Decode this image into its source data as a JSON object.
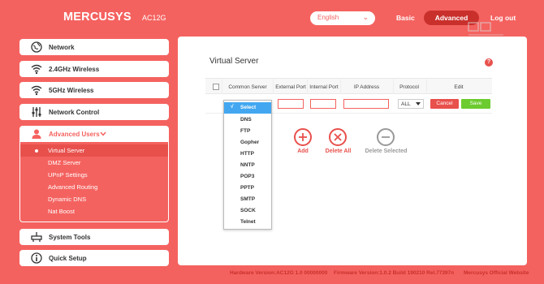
{
  "header": {
    "logo": "MERCUSYS",
    "model": "AC12G",
    "language": "English",
    "nav_basic": "Basic",
    "nav_advanced": "Advanced",
    "nav_logout": "Log out"
  },
  "sidebar": {
    "items": [
      {
        "label": "Network",
        "icon": "globe-icon"
      },
      {
        "label": "2.4GHz Wireless",
        "icon": "wifi-icon"
      },
      {
        "label": "5GHz Wireless",
        "icon": "wifi-icon"
      },
      {
        "label": "Network Control",
        "icon": "sliders-icon"
      },
      {
        "label": "Advanced Users",
        "icon": "user-icon"
      },
      {
        "label": "System Tools",
        "icon": "tools-icon"
      },
      {
        "label": "Quick Setup",
        "icon": "info-icon"
      }
    ],
    "submenu": [
      {
        "label": "Virtual Server"
      },
      {
        "label": "DMZ Server"
      },
      {
        "label": "UPnP Settings"
      },
      {
        "label": "Advanced Routing"
      },
      {
        "label": "Dynamic DNS"
      },
      {
        "label": "Nat Boost"
      }
    ]
  },
  "main": {
    "title": "Virtual Server",
    "columns": [
      "Common Server",
      "External Port",
      "Internal Port",
      "IP Address",
      "Protocol",
      "Edit"
    ],
    "protocol_value": "ALL",
    "cancel_label": "Cancel",
    "save_label": "Save",
    "dropdown": {
      "selected": "Select",
      "options": [
        "DNS",
        "FTP",
        "Gopher",
        "HTTP",
        "NNTP",
        "POP3",
        "PPTP",
        "SMTP",
        "SOCK",
        "Telnet"
      ]
    },
    "actions": {
      "add": "Add",
      "delete_all": "Delete All",
      "delete_selected": "Delete Selected"
    }
  },
  "footer": {
    "hardware": "Hardware Version:AC12G 1.0 00000000",
    "firmware": "Firmware Version:1.0.2 Build 190210 Rel.77397n",
    "website": "Mercusys Official Website"
  },
  "colors": {
    "brand": "#f4625f",
    "accent_dark": "#c9302c",
    "save_green": "#6ccb2e",
    "dropdown_highlight": "#42a7f0"
  }
}
